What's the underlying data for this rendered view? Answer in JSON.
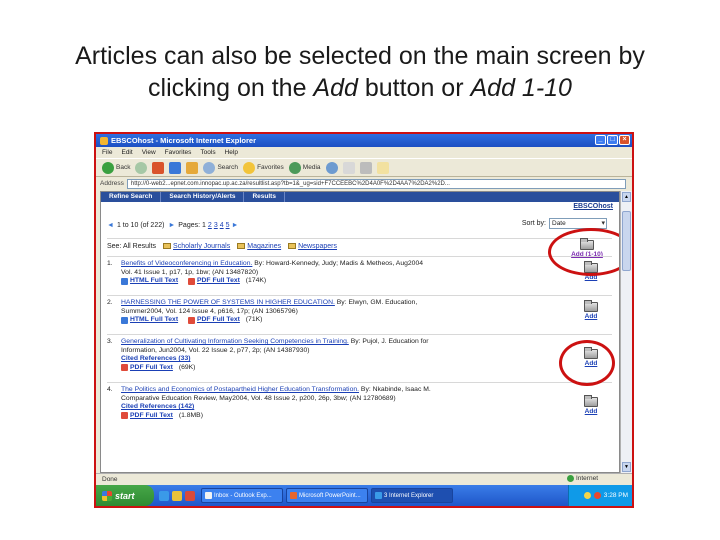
{
  "caption": {
    "line1": "Articles can also be selected on the main screen by",
    "line2_prefix": "clicking on the ",
    "line2_add": "Add",
    "line2_mid": " button or ",
    "line2_add10": "Add 1-10"
  },
  "browser": {
    "title": "EBSCOhost - Microsoft Internet Explorer",
    "menu": [
      "File",
      "Edit",
      "View",
      "Favorites",
      "Tools",
      "Help"
    ],
    "toolbar": {
      "back": "Back",
      "search": "Search",
      "favorites": "Favorites",
      "media": "Media"
    },
    "address_label": "Address",
    "address": "http://0-web2...epnet.com.innopac.up.ac.za/resultlist.asp?tb=1&_ug=sid+F7CCEEBC%2D4A0F%2D4AA7%2DA2%2D...",
    "go": "Go",
    "status_left": "Done",
    "status_zone": "Internet"
  },
  "ebsco": {
    "nav_tabs": [
      "Refine Search",
      "Search History/Alerts",
      "Results"
    ],
    "brand_link": "EBSCOhost",
    "results_range": "1 to 10",
    "results_total": "(of 222)",
    "pages_label": "Pages:",
    "pages": [
      "1",
      "2",
      "3",
      "4",
      "5"
    ],
    "sort_label": "Sort by:",
    "sort_value": "Date",
    "see_label": "See: All Results",
    "see_links": [
      "Scholarly Journals",
      "Magazines",
      "Newspapers"
    ],
    "add_all_label": "Add (1-10)",
    "add_label": "Add"
  },
  "results": [
    {
      "num": "1.",
      "title": "Benefits of Videoconferencing in Education.",
      "meta": "By: Howard-Kennedy, Judy; Madis & Metheos, Aug2004",
      "meta2": "Vol. 41 Issue 1, p17, 1p, 1bw; (AN 13487820)",
      "links": [
        "HTML Full Text",
        "PDF Full Text"
      ],
      "pdf_size": "(174K)"
    },
    {
      "num": "2.",
      "title": "HARNESSING THE POWER OF SYSTEMS IN HIGHER EDUCATION.",
      "meta": "By: Elwyn, GM. Education,",
      "meta2": "Summer2004, Vol. 124 Issue 4, p616, 17p; (AN 13065796)",
      "links": [
        "HTML Full Text",
        "PDF Full Text"
      ],
      "pdf_size": "(71K)"
    },
    {
      "num": "3.",
      "title": "Generalization of Cultivating Information Seeking Competencies in Training.",
      "meta": "By: Pujol, J. Education for",
      "meta2": "Information, Jun2004, Vol. 22 Issue 2, p77, 2p; (AN 14387930)",
      "cited": "Cited References (33)",
      "links": [
        "PDF Full Text"
      ],
      "pdf_size": "(69K)"
    },
    {
      "num": "4.",
      "title": "The Politics and Economics of Postapartheid Higher Education Transformation.",
      "meta": "By: Nkabinde, Isaac M.",
      "meta2": "Comparative Education Review, May2004, Vol. 48 Issue 2, p200, 26p, 3bw; (AN 12780689)",
      "cited": "Cited References (142)",
      "links": [
        "PDF Full Text"
      ],
      "pdf_size": "(1.8MB)"
    }
  ],
  "taskbar": {
    "start": "start",
    "tasks": [
      "Inbox - Outlook Exp...",
      "Microsoft PowerPoint...",
      "3 Internet Explorer"
    ],
    "clock": "3:28 PM"
  },
  "colors": {
    "highlight": "#cc1111",
    "link": "#1a3fb5",
    "nav": "#2a4f9c"
  }
}
